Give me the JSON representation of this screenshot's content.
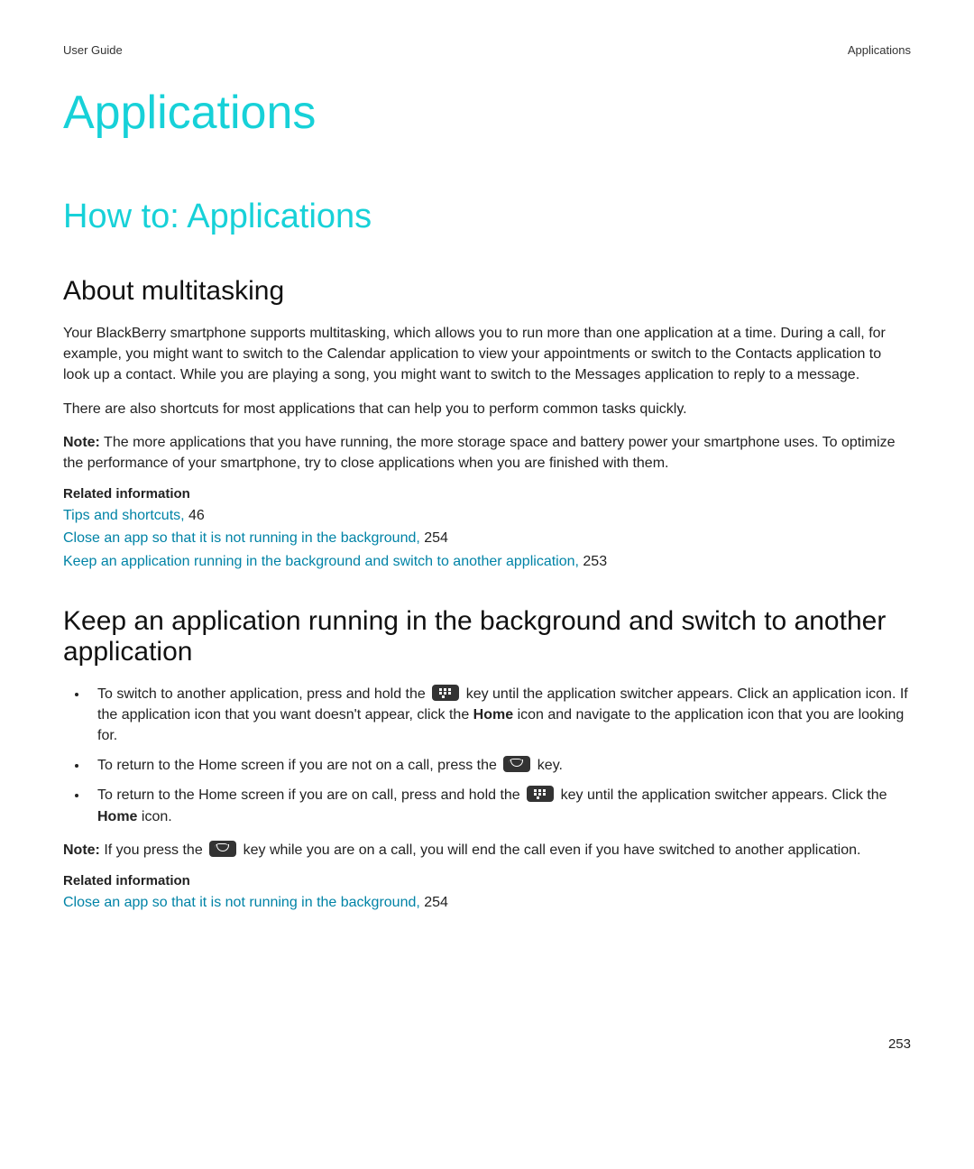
{
  "header": {
    "left": "User Guide",
    "right": "Applications"
  },
  "title": "Applications",
  "subtitle": "How to: Applications",
  "section1": {
    "heading": "About multitasking",
    "p1": "Your BlackBerry smartphone supports multitasking, which allows you to run more than one application at a time. During a call, for example, you might want to switch to the Calendar application to view your appointments or switch to the Contacts application to look up a contact. While you are playing a song, you might want to switch to the Messages application to reply to a message.",
    "p2": "There are also shortcuts for most applications that can help you to perform common tasks quickly.",
    "note_label": "Note:",
    "note_text": " The more applications that you have running, the more storage space and battery power your smartphone uses. To optimize the performance of your smartphone, try to close applications when you are finished with them.",
    "related_label": "Related information",
    "links": [
      {
        "text": "Tips and shortcuts,",
        "page": " 46"
      },
      {
        "text": "Close an app so that it is not running in the background,",
        "page": " 254"
      },
      {
        "text": "Keep an application running in the background and switch to another application,",
        "page": " 253"
      }
    ]
  },
  "section2": {
    "heading": "Keep an application running in the background and switch to another application",
    "b1a": "To switch to another application, press and hold the ",
    "b1b": " key until the application switcher appears. Click an application icon. If the application icon that you want doesn't appear, click the ",
    "b1_home": "Home",
    "b1c": " icon and navigate to the application icon that you are looking for.",
    "b2a": "To return to the Home screen if you are not on a call, press the ",
    "b2b": " key.",
    "b3a": "To return to the Home screen if you are on call, press and hold the ",
    "b3b": " key until the application switcher appears. Click the ",
    "b3_home": "Home",
    "b3c": " icon.",
    "note_label": "Note:",
    "note_a": " If you press the ",
    "note_b": " key while you are on a call, you will end the call even if you have switched to another application.",
    "related_label": "Related information",
    "links": [
      {
        "text": "Close an app so that it is not running in the background,",
        "page": " 254"
      }
    ]
  },
  "page_number": "253"
}
